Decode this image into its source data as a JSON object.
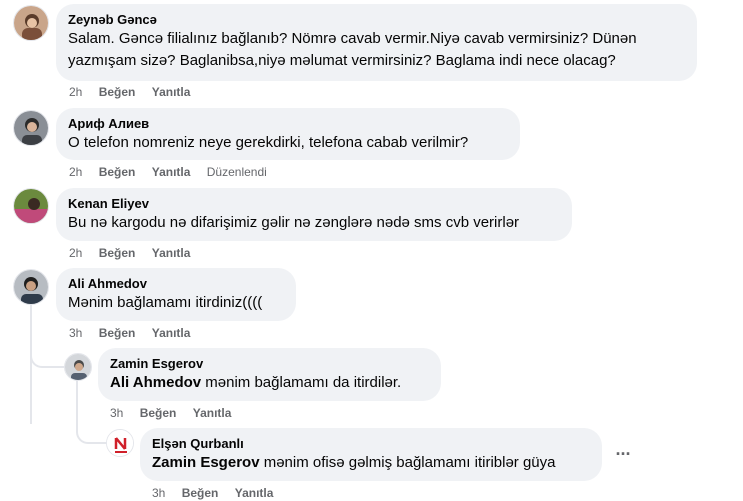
{
  "comments": [
    {
      "author": "Zeynəb Gəncə",
      "lines": [
        "Salam. Gəncə filialınız bağlanıb? Nömrə cavab vermir.Niyə cavab vermirsiniz? Dünən",
        "yazmışam sizə? Baglanibsa,niyə məlumat vermirsiniz? Baglama indi nece olacag?"
      ],
      "time": "2h",
      "like": "Beğen",
      "reply": "Yanıtla"
    },
    {
      "author": "Ариф Алиев",
      "lines": [
        "O telefon nomreniz neye gerekdirki, telefona cabab verilmir?"
      ],
      "time": "2h",
      "like": "Beğen",
      "reply": "Yanıtla",
      "edited": "Düzenlendi"
    },
    {
      "author": "Kenan Eliyev",
      "lines": [
        "Bu nə kargodu nə difarişimiz gəlir nə zənglərə nədə sms cvb verirlər"
      ],
      "time": "2h",
      "like": "Beğen",
      "reply": "Yanıtla"
    },
    {
      "author": "Ali Ahmedov",
      "lines": [
        "Mənim bağlamamı itirdiniz(((("
      ],
      "time": "3h",
      "like": "Beğen",
      "reply": "Yanıtla"
    },
    {
      "author": "Zamin Esgerov",
      "mention": "Ali Ahmedov",
      "text": " mənim bağlamamı da itirdilər.",
      "time": "3h",
      "like": "Beğen",
      "reply": "Yanıtla"
    },
    {
      "author": "Elşən Qurbanlı",
      "mention": "Zamin Esgerov",
      "text": " mənim ofisə gəlmiş bağlamamı itiriblər güya",
      "time": "3h",
      "like": "Beğen",
      "reply": "Yanıtla"
    }
  ],
  "more_icon": "ellipsis-horizontal",
  "more_label": "···",
  "colors": {
    "bubble": "#f0f2f5",
    "meta": "#65676b",
    "text": "#050505",
    "thread_line": "#e4e6eb"
  }
}
